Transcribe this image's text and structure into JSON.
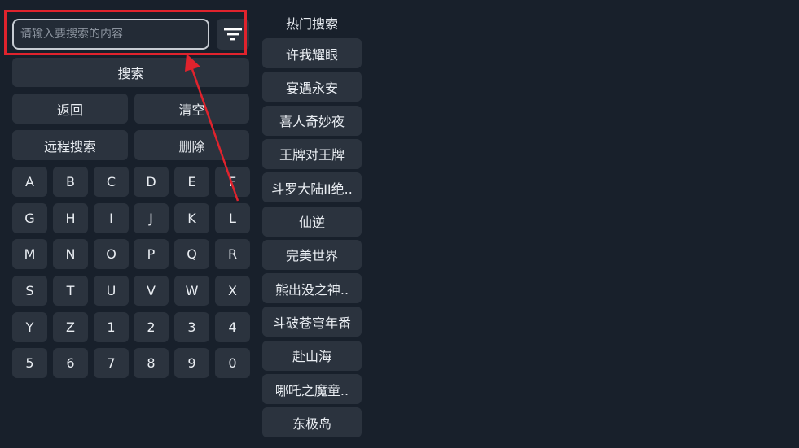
{
  "search": {
    "placeholder": "请输入要搜索的内容",
    "value": ""
  },
  "buttons": {
    "search": "搜索",
    "back": "返回",
    "clear": "清空",
    "remote_search": "远程搜索",
    "delete": "删除"
  },
  "keyboard": {
    "keys": [
      "A",
      "B",
      "C",
      "D",
      "E",
      "F",
      "G",
      "H",
      "I",
      "J",
      "K",
      "L",
      "M",
      "N",
      "O",
      "P",
      "Q",
      "R",
      "S",
      "T",
      "U",
      "V",
      "W",
      "X",
      "Y",
      "Z",
      "1",
      "2",
      "3",
      "4",
      "5",
      "6",
      "7",
      "8",
      "9",
      "0"
    ]
  },
  "hot": {
    "title": "热门搜索",
    "items": [
      "许我耀眼",
      "宴遇永安",
      "喜人奇妙夜",
      "王牌对王牌",
      "斗罗大陆II绝..",
      "仙逆",
      "完美世界",
      "熊出没之神..",
      "斗破苍穹年番",
      "赴山海",
      "哪吒之魔童..",
      "东极岛"
    ]
  },
  "icons": {
    "filter": "filter-icon"
  },
  "colors": {
    "background": "#18202b",
    "key": "#2b333e",
    "highlight": "#e0232d"
  }
}
